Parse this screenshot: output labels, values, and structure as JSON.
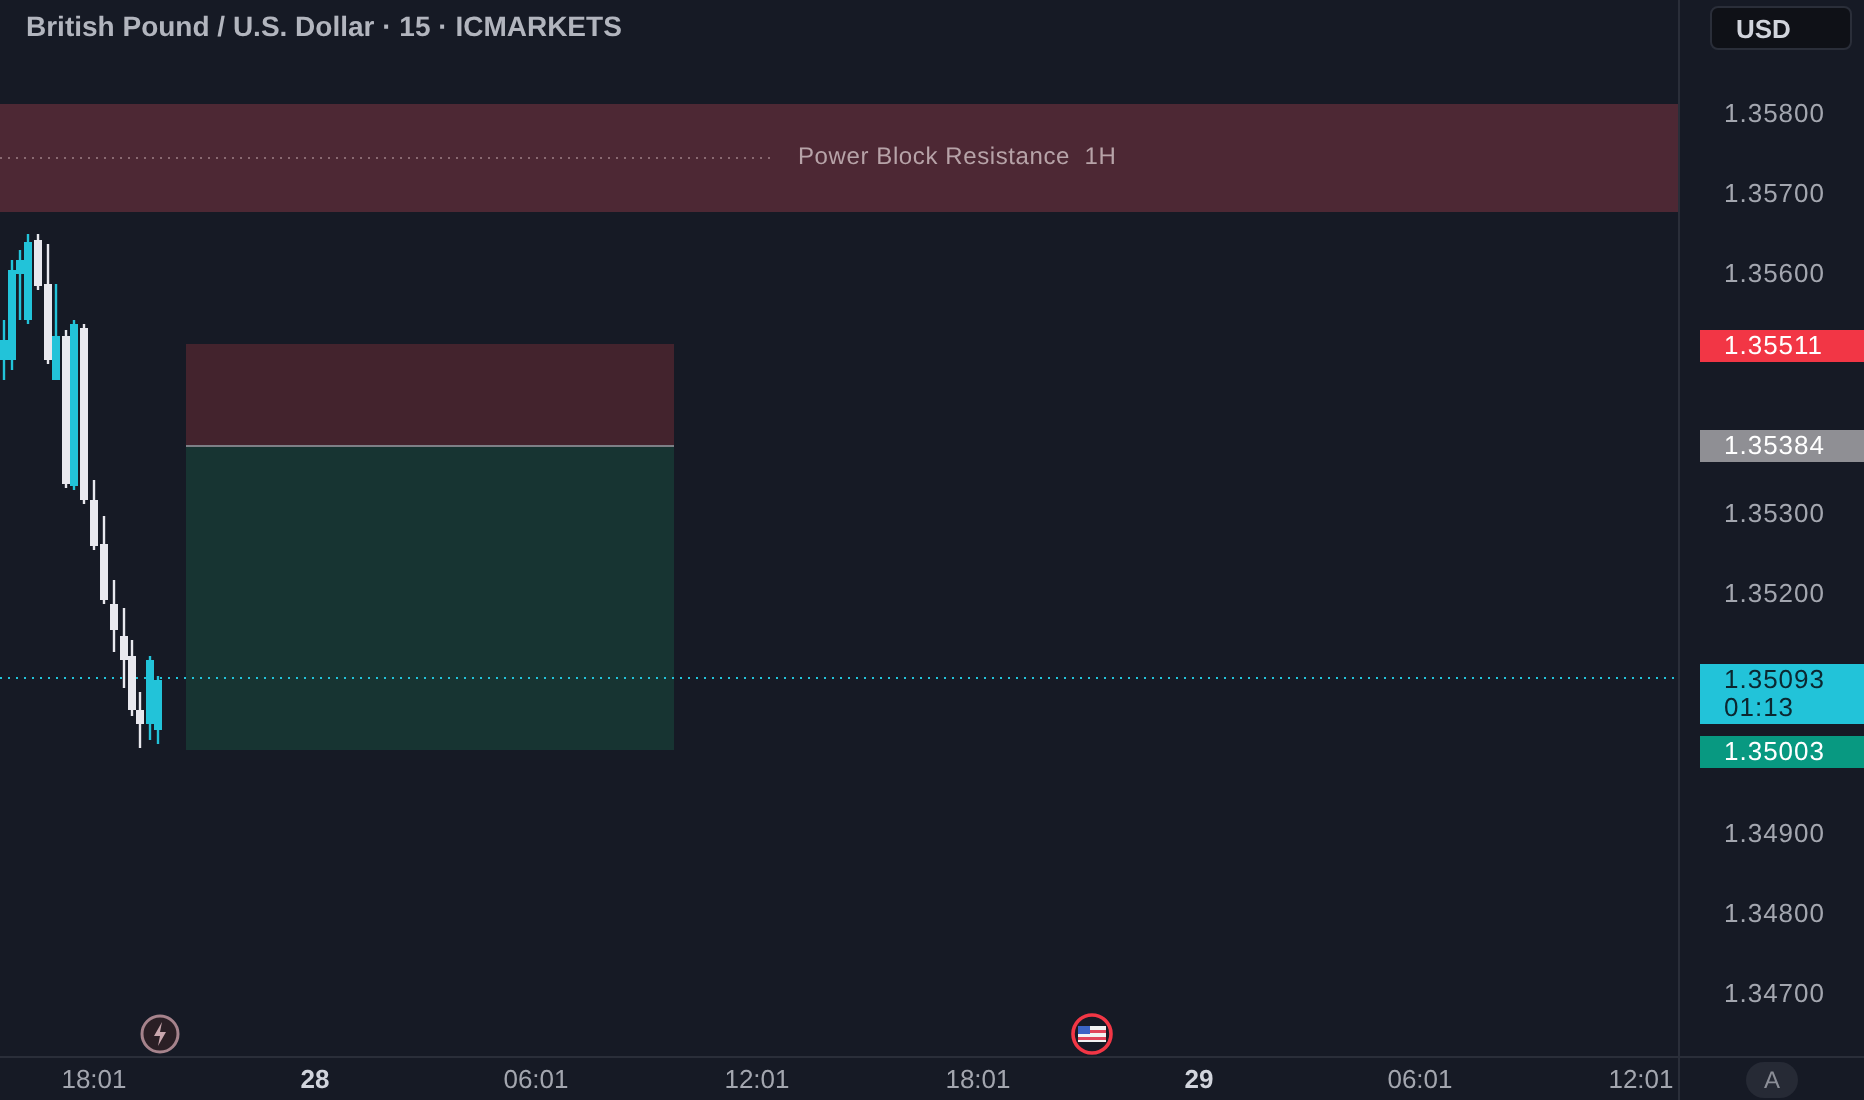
{
  "title": "British Pound / U.S. Dollar · 15 · ICMARKETS",
  "currency_button": "USD",
  "zone": {
    "label": "Power Block Resistance  1H"
  },
  "price_axis": {
    "ticks": [
      "1.35800",
      "1.35700",
      "1.35600",
      "1.35300",
      "1.35200",
      "1.34900",
      "1.34800",
      "1.34700"
    ]
  },
  "price_labels": [
    {
      "text": "1.35511",
      "color": "#f23645"
    },
    {
      "text": "1.35384",
      "color": "#8f8f94"
    },
    {
      "text": "1.35093",
      "countdown": "01:13",
      "color": "#22c3d9"
    },
    {
      "text": "1.35003",
      "color": "#089981"
    }
  ],
  "events": [
    {
      "kind": "bolt"
    },
    {
      "kind": "flag"
    }
  ],
  "time_axis": [
    {
      "text": "18:01",
      "kind": "time"
    },
    {
      "text": "28",
      "kind": "date"
    },
    {
      "text": "06:01",
      "kind": "time"
    },
    {
      "text": "12:01",
      "kind": "time"
    },
    {
      "text": "18:01",
      "kind": "time"
    },
    {
      "text": "29",
      "kind": "date"
    },
    {
      "text": "06:01",
      "kind": "time"
    },
    {
      "text": "12:01",
      "kind": "time"
    }
  ],
  "auto_button": "A"
}
